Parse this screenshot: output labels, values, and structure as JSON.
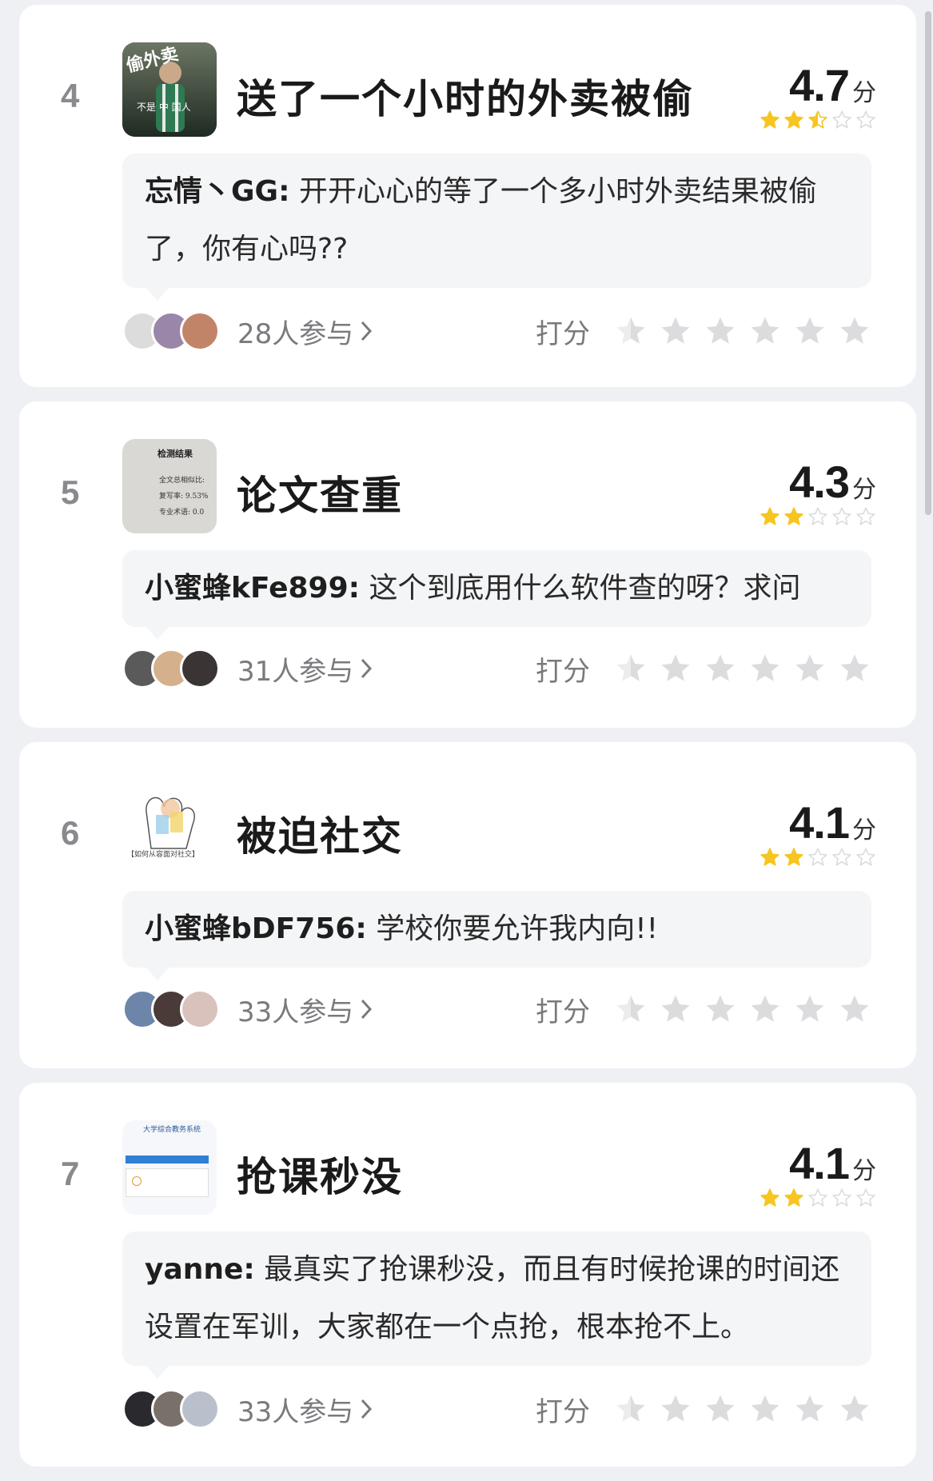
{
  "colors": {
    "star_filled": "#f7c520",
    "star_empty": "#dcdcde",
    "background": "#eef0f4",
    "card": "#ffffff",
    "comment_bg": "#f4f5f7"
  },
  "score_unit": "分",
  "rate_label": "打分",
  "cards": [
    {
      "rank": "4",
      "title": "送了一个小时的外卖被偷",
      "score": "4.7",
      "stars": 2.5,
      "thumb_caption": "偷外卖",
      "thumb_caption_2": "不是 中 国人",
      "comment_author": "忘情丶GG:",
      "comment_text": "开开心心的等了一个多小时外卖结果被偷了，你有心吗??",
      "participants": "28人参与"
    },
    {
      "rank": "5",
      "title": "论文查重",
      "score": "4.3",
      "stars": 2,
      "thumb_caption": "检测结果",
      "thumb_lines": [
        "全文总相似比:",
        "复写率: 9.53%",
        "专业术语: 0.0"
      ],
      "comment_author": "小蜜蜂kFe899:",
      "comment_text": "这个到底用什么软件查的呀？求问",
      "participants": "31人参与"
    },
    {
      "rank": "6",
      "title": "被迫社交",
      "score": "4.1",
      "stars": 2,
      "thumb_caption": "【如何从容面对社交】",
      "comment_author": "小蜜蜂bDF756:",
      "comment_text": "学校你要允许我内向!!",
      "participants": "33人参与"
    },
    {
      "rank": "7",
      "title": "抢课秒没",
      "score": "4.1",
      "stars": 2,
      "thumb_caption": "大学综合教务系统",
      "comment_author": "yanne:",
      "comment_text": "最真实了抢课秒没，而且有时候抢课的时间还设置在军训，大家都在一个点抢，根本抢不上。",
      "participants": "33人参与"
    }
  ]
}
